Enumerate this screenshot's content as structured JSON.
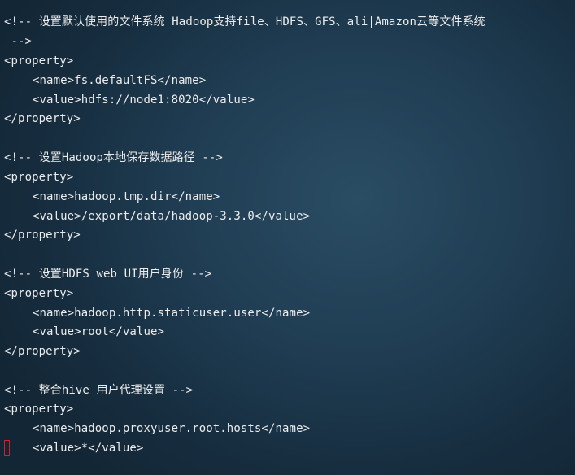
{
  "terminal": {
    "lines": [
      "<!-- 设置默认使用的文件系统 Hadoop支持file、HDFS、GFS、ali|Amazon云等文件系统",
      " -->",
      "<property>",
      "<name>fs.defaultFS</name>",
      "<value>hdfs://node1:8020</value>",
      "</property>",
      "<!-- 设置Hadoop本地保存数据路径 -->",
      "<property>",
      "<name>hadoop.tmp.dir</name>",
      "<value>/export/data/hadoop-3.3.0</value>",
      "</property>",
      "<!-- 设置HDFS web UI用户身份 -->",
      "<property>",
      "<name>hadoop.http.staticuser.user</name>",
      "<value>root</value>",
      "</property>",
      "<!-- 整合hive 用户代理设置 -->",
      "<property>",
      "<name>hadoop.proxyuser.root.hosts</name>",
      "<value>*</value>"
    ]
  },
  "colors": {
    "text": "#ececec",
    "cursor": "#d21f2b",
    "background": "#1f3c52"
  }
}
